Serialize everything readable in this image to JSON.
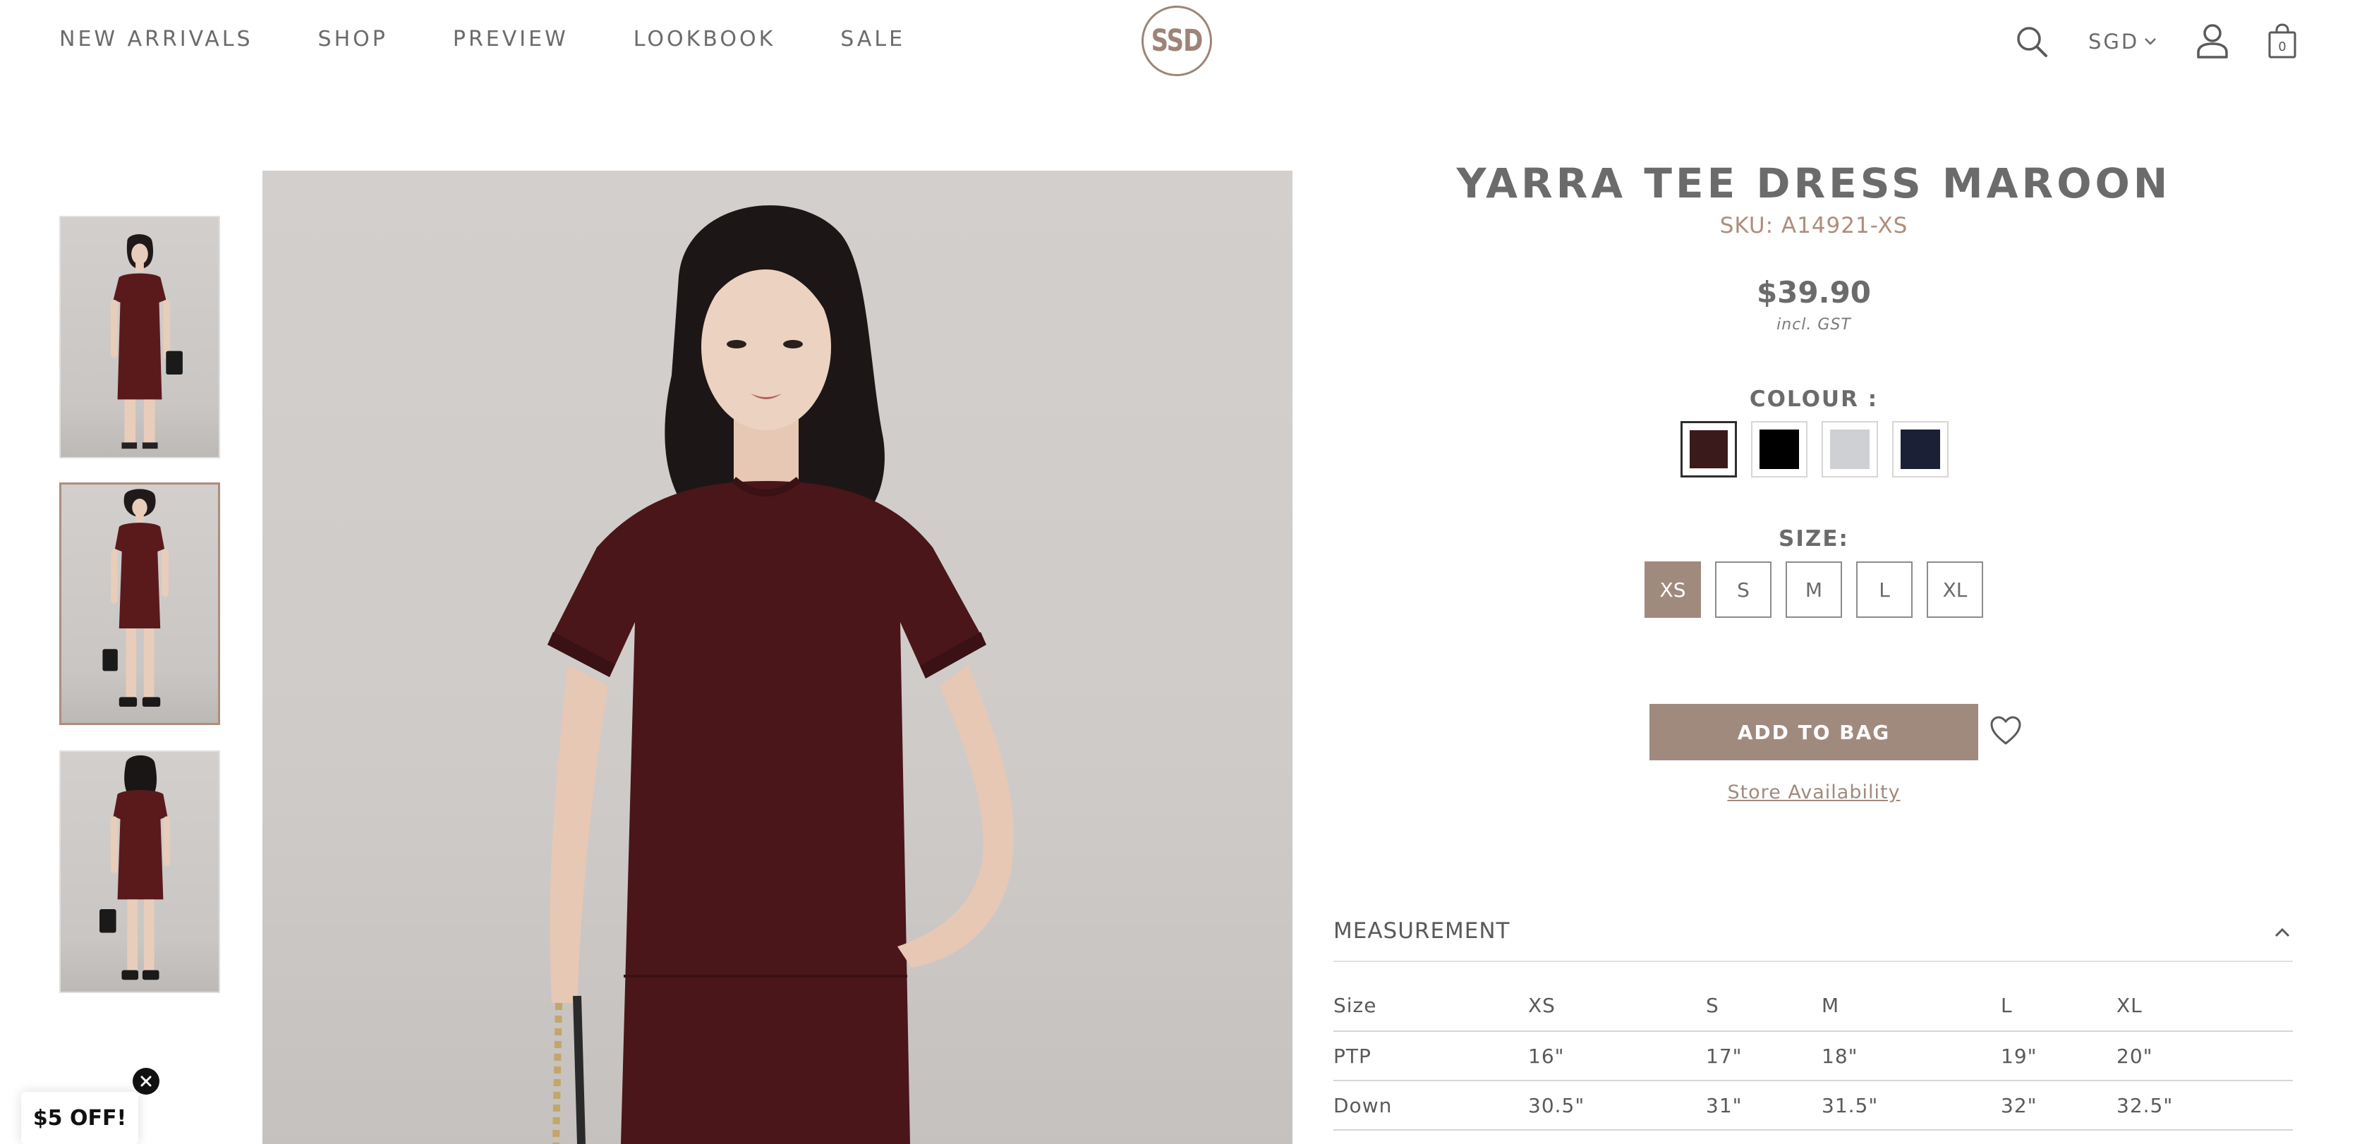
{
  "header": {
    "nav": [
      "NEW ARRIVALS",
      "SHOP",
      "PREVIEW",
      "LOOKBOOK",
      "SALE"
    ],
    "logo_text": "SSD",
    "currency": "SGD",
    "bag_count": "0",
    "icons": {
      "search": "search-icon",
      "chevron": "chevron-down-icon",
      "user": "user-icon",
      "bag": "shopping-bag-icon"
    }
  },
  "gallery": {
    "thumbnail_count": 3,
    "active_index": 1
  },
  "product": {
    "title": "YARRA TEE DRESS MAROON",
    "sku": "SKU: A14921-XS",
    "price": "$39.90",
    "gst": "incl. GST",
    "colour_label": "COLOUR :",
    "colours": [
      "#3b1a1c",
      "#000000",
      "#cfd0d4",
      "#1b2036"
    ],
    "selected_colour": 0,
    "size_label": "SIZE:",
    "sizes": [
      "XS",
      "S",
      "M",
      "L",
      "XL"
    ],
    "selected_size": 0,
    "add_to_bag": "ADD TO BAG",
    "store_availability": "Store Availability",
    "wishlist_icon": "heart-icon"
  },
  "measurement": {
    "title": "MEASUREMENT",
    "headers": [
      "Size",
      "XS",
      "S",
      "M",
      "L",
      "XL"
    ],
    "rows": [
      [
        "PTP",
        "16\"",
        "17\"",
        "18\"",
        "19\"",
        "20\""
      ],
      [
        "Down",
        "30.5\"",
        "31\"",
        "31.5\"",
        "32\"",
        "32.5\""
      ]
    ]
  },
  "promo": {
    "label": "$5 OFF!"
  },
  "colors": {
    "accent": "#a08a7e",
    "sku": "#b08c7c",
    "text": "#6b6b6b"
  }
}
